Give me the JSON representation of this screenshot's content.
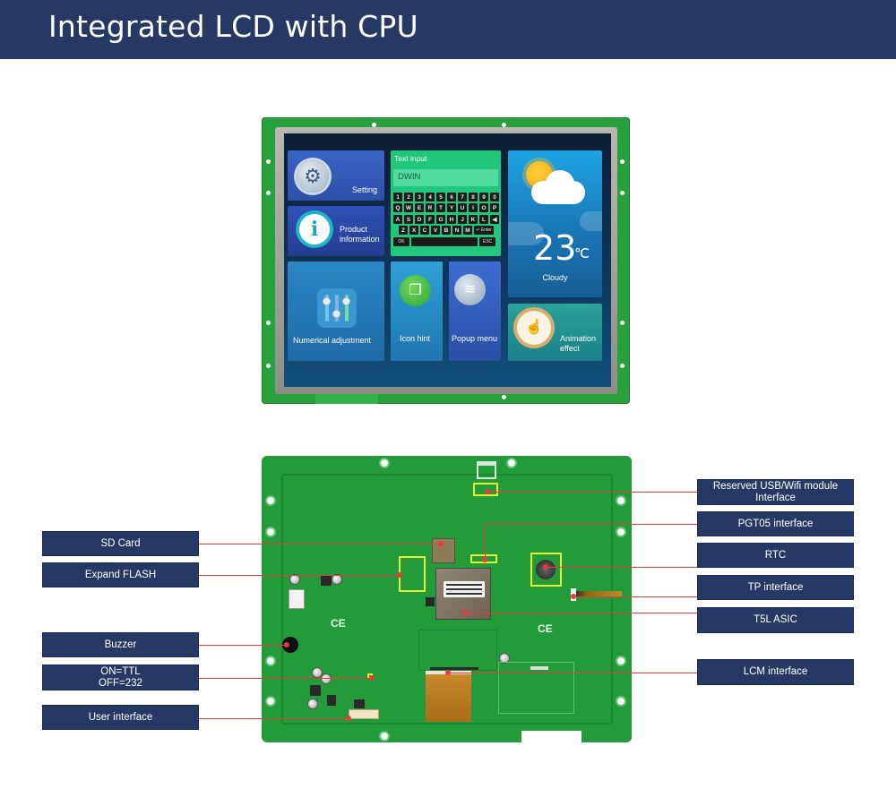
{
  "header": {
    "title": "Integrated LCD with CPU"
  },
  "colors": {
    "header_bg": "#263964",
    "label_bg": "#263964",
    "callout_line": "#ea3b3b",
    "highlight_box": "#e6f02a",
    "pcb_green": "#239b3b"
  },
  "lcd_screen": {
    "tiles": {
      "setting": {
        "label": "Setting",
        "icon": "gear-icon"
      },
      "product": {
        "label_line1": "Product",
        "label_line2": "information",
        "icon": "info-icon"
      },
      "text_input": {
        "title": "Text input",
        "field_value": "DWIN",
        "keyboard": {
          "row1": [
            "1",
            "2",
            "3",
            "4",
            "5",
            "6",
            "7",
            "8",
            "9",
            "0"
          ],
          "row2": [
            "Q",
            "W",
            "E",
            "R",
            "T",
            "Y",
            "U",
            "I",
            "O",
            "P"
          ],
          "row3": [
            "A",
            "S",
            "D",
            "F",
            "G",
            "H",
            "J",
            "K",
            "L",
            "◀"
          ],
          "row4": [
            "Z",
            "X",
            "C",
            "V",
            "B",
            "N",
            "M"
          ],
          "enter_key": "↵ Enter",
          "ok_key": "OK",
          "esc_key": "ESC"
        }
      },
      "weather": {
        "temperature": "23",
        "unit": "℃",
        "condition": "Cloudy",
        "icon": "sun-cloud-icon"
      },
      "numerical": {
        "label": "Numerical adjustment",
        "icon": "sliders-icon"
      },
      "icon_hint": {
        "label": "Icon hint",
        "icon": "windows-icon"
      },
      "popup_menu": {
        "label": "Popup menu",
        "icon": "layers-icon"
      },
      "animation": {
        "label_line1": "Animation",
        "label_line2": "effect",
        "icon": "touch-hand-icon"
      }
    }
  },
  "callouts": {
    "left": [
      {
        "id": "sd-card",
        "text": "SD Card"
      },
      {
        "id": "expand-flash",
        "text": "Expand FLASH"
      },
      {
        "id": "buzzer",
        "text": "Buzzer"
      },
      {
        "id": "ttl-232",
        "text": "ON=TTL\nOFF=232"
      },
      {
        "id": "user-interface",
        "text": "User interface"
      }
    ],
    "right": [
      {
        "id": "usb-wifi",
        "text": "Reserved USB/Wifi module\nInterface"
      },
      {
        "id": "pgt05",
        "text": "PGT05 interface"
      },
      {
        "id": "rtc",
        "text": "RTC"
      },
      {
        "id": "tp-interface",
        "text": "TP interface"
      },
      {
        "id": "t5l-asic",
        "text": "T5L ASIC"
      },
      {
        "id": "lcm-interface",
        "text": "LCM interface"
      }
    ]
  },
  "pcb_marks": {
    "ce": "CE"
  }
}
